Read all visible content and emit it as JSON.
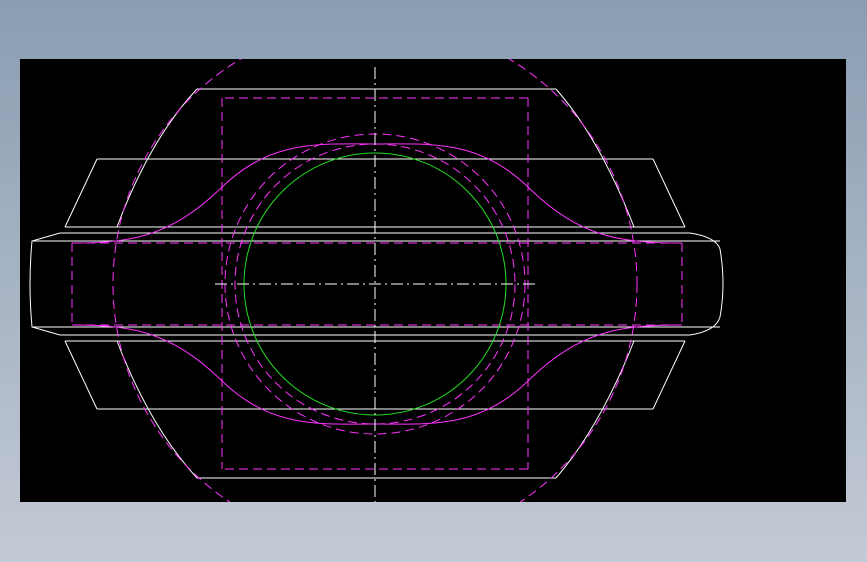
{
  "drawing": {
    "background_color": "#000000",
    "visible_edge_color": "#ffffff",
    "hidden_edge_color": "#ff33ff",
    "bore_circle_color": "#22dd22",
    "centerline_color": "#ffffff"
  }
}
